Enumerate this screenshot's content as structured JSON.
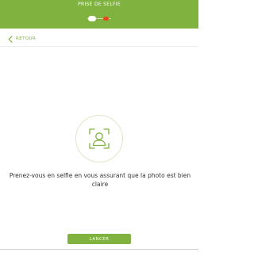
{
  "header": {
    "title": "PRISE DE SELFIE",
    "color": "#7fb23f",
    "stepper": {
      "current_step": 1,
      "total_steps": 2,
      "active_color": "#ffffff",
      "pending_color": "#e64a19"
    }
  },
  "nav": {
    "back_label": "RETOUR",
    "back_icon": "chevron-left-icon"
  },
  "main": {
    "illustration_icon": "face-scan-icon",
    "instruction": "Prenez-vous en selfie en vous assurant que la photo est bien claire"
  },
  "footer": {
    "launch_label": "LANCER"
  }
}
